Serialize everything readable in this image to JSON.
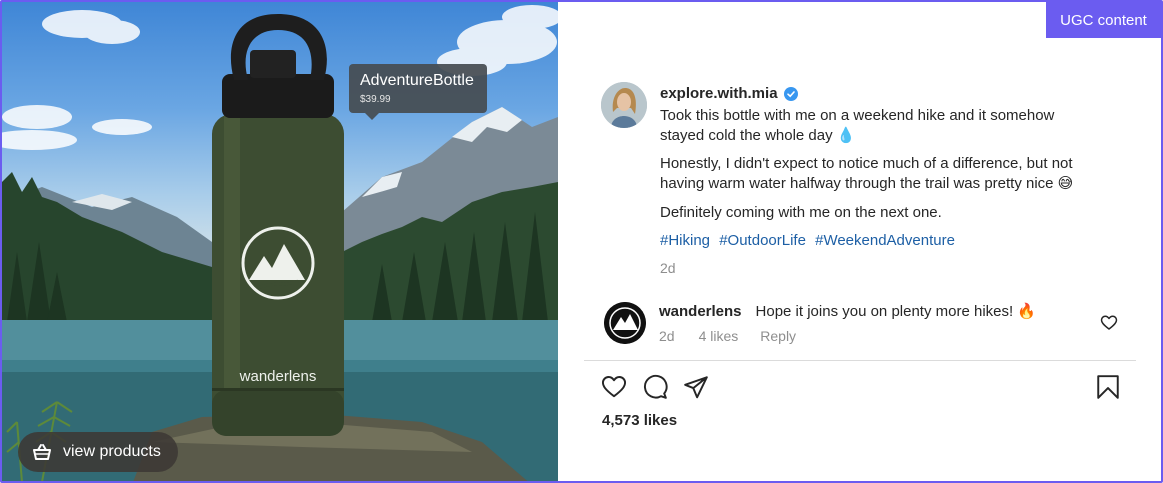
{
  "badge": {
    "label": "UGC content"
  },
  "photo": {
    "bottle_brand": "wanderlens",
    "product_tag": {
      "name": "AdventureBottle",
      "price": "$39.99"
    },
    "view_products_label": "view products"
  },
  "post": {
    "username": "explore.with.mia",
    "verified": true,
    "caption_lines": [
      "Took this bottle with me on a weekend hike and it somehow stayed cold the whole day 💧",
      "Honestly, I didn't expect to notice much of a difference, but not having warm water halfway through the trail was pretty nice 😅",
      "Definitely coming with me on the next one."
    ],
    "hashtags": [
      "#Hiking",
      "#OutdoorLife",
      "#WeekendAdventure"
    ],
    "time": "2d"
  },
  "comment": {
    "username": "wanderlens",
    "text": "Hope it joins you on plenty more hikes! 🔥",
    "time": "2d",
    "likes": "4 likes",
    "reply_label": "Reply"
  },
  "actions": {
    "icons": [
      "heart-icon",
      "comment-icon",
      "share-icon",
      "bookmark-icon"
    ]
  },
  "likes": "4,573 likes",
  "colors": {
    "accent": "#6b5cf0",
    "hashtag": "#1d5fa5",
    "verified": "#3897f0",
    "bottle": "#3d4d32"
  }
}
